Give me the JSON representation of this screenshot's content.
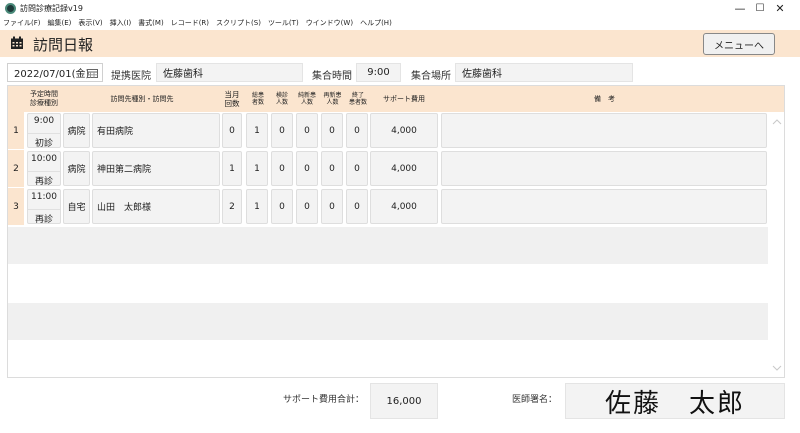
{
  "window": {
    "title": "訪問診療記録v19",
    "minimize": "—",
    "maximize": "☐",
    "close": "✕"
  },
  "menu": [
    "ファイル(F)",
    "編集(E)",
    "表示(V)",
    "挿入(I)",
    "書式(M)",
    "レコード(R)",
    "スクリプト(S)",
    "ツール(T)",
    "ウインドウ(W)",
    "ヘルプ(H)"
  ],
  "header": {
    "title": "訪問日報",
    "menu_button": "メニューへ",
    "accent_color": "#fbe5cf"
  },
  "form": {
    "date": "2022/07/01(金)",
    "clinic_label": "提携医院",
    "clinic_value": "佐藤歯科",
    "meet_time_label": "集合時間",
    "meet_time_value": "9:00",
    "meet_place_label": "集合場所",
    "meet_place_value": "佐藤歯科"
  },
  "table": {
    "headers": {
      "time": "予定時間\n診療種別",
      "dest": "訪問先種別・訪問先",
      "month_count": "当月\n回数",
      "total": "総患\n者数",
      "exam": "検診\n人数",
      "new": "純新患\n人数",
      "renew": "再新患\n人数",
      "ended": "終了\n患者数",
      "support_fee": "サポート費用",
      "remarks": "備　考"
    },
    "rows": [
      {
        "num": "1",
        "time": "9:00",
        "kind": "初診",
        "type": "病院",
        "dest": "有田病院",
        "month_count": "0",
        "total": "1",
        "exam": "0",
        "new": "0",
        "renew": "0",
        "ended": "0",
        "fee": "4,000",
        "remarks": ""
      },
      {
        "num": "2",
        "time": "10:00",
        "kind": "再診",
        "type": "病院",
        "dest": "神田第二病院",
        "month_count": "1",
        "total": "1",
        "exam": "0",
        "new": "0",
        "renew": "0",
        "ended": "0",
        "fee": "4,000",
        "remarks": ""
      },
      {
        "num": "3",
        "time": "11:00",
        "kind": "再診",
        "type": "自宅",
        "dest": "山田　太郎様",
        "month_count": "2",
        "total": "1",
        "exam": "0",
        "new": "0",
        "renew": "0",
        "ended": "0",
        "fee": "4,000",
        "remarks": ""
      }
    ]
  },
  "footer": {
    "total_label": "サポート費用合計：",
    "total_value": "16,000",
    "signature_label": "医師署名：",
    "signature_value": "佐藤　太郎"
  }
}
